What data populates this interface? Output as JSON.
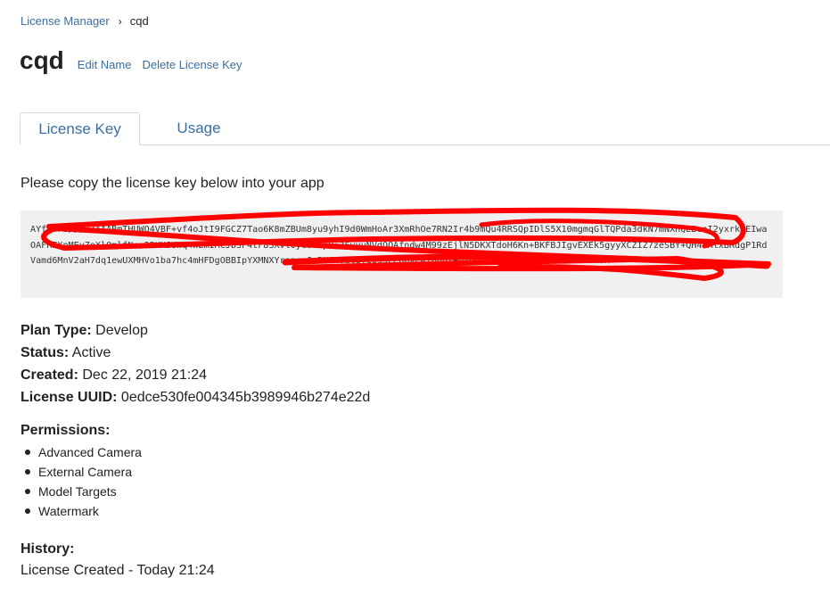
{
  "breadcrumb": {
    "root": "License Manager",
    "separator": "›",
    "current": "cqd"
  },
  "header": {
    "title": "cqd",
    "edit_name": "Edit Name",
    "delete_key": "Delete License Key"
  },
  "tabs": [
    {
      "label": "License Key",
      "active": true
    },
    {
      "label": "Usage",
      "active": false
    }
  ],
  "instruction": "Please copy the license key below into your app",
  "license_key": "AYf3wP3/////AAABmTHUWO4VBF+vf4oJtI9FGCZ7Tao6K8mZBUm8yu9yhI9d0WmHoAr3XmRhOe7RN2Ir4b9mQu4RRSQpIDlS5X10mgmqGlTQPda3dkN7mNXhQEBeoI2yxrkeEIwaOAFREXnMEvZoXlQmlfN+x2RKHJUWq4WEmIMcJbSF4tF83Xvl0ye8o5pU+3FvyuNVdOOAfndw4M99zEjlN5DKXTdoH6Kn+BKFBJIgvEXEk5gyyXCZIZ7zeSBY+QH4kAlxBRdgP1RdVamd6MnV2aH7dq1ewUXMHVo1ba7hc4mHFDgOBBIpYXMNXYrapraJeBHGxvGluYC093LeopXewi0buI+OjdoXjV9ocli9VWcqQABLfh5ml3K",
  "details": {
    "plan_type_label": "Plan Type:",
    "plan_type": "Develop",
    "status_label": "Status:",
    "status": "Active",
    "created_label": "Created:",
    "created": "Dec 22, 2019 21:24",
    "uuid_label": "License UUID:",
    "uuid": "0edce530fe004345b3989946b274e22d"
  },
  "permissions": {
    "title": "Permissions:",
    "items": [
      "Advanced Camera",
      "External Camera",
      "Model Targets",
      "Watermark"
    ]
  },
  "history": {
    "title": "History:",
    "entries": [
      "License Created - Today 21:24"
    ]
  },
  "colors": {
    "link": "#3b6e9e",
    "scribble": "#ff0000",
    "keybox_bg": "#f0f0f0"
  }
}
